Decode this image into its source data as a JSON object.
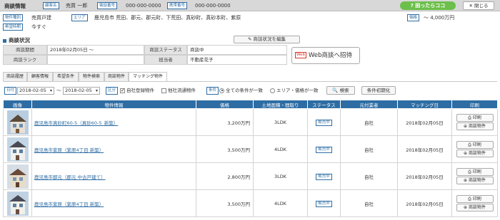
{
  "header": {
    "title": "商談情報",
    "status_tag": "顧客名",
    "status_value": "売買 一郎",
    "phone_tag": "電話番号",
    "phone_value": "000-000-0000",
    "mobile_tag": "携帯番号",
    "mobile_value": "000-000-0000",
    "help_label": "困ったらココ",
    "close_label": "閉じる"
  },
  "conditions": {
    "type_tag": "物件種別",
    "type_value": "売買戸建",
    "area_tag": "エリア",
    "area_value": "鹿児島市 荒田、郡元、郡元町、下荒田、真砂町、真砂本町、紫原",
    "price_tag": "価格",
    "price_value": "～ 4,000万円",
    "timing_tag": "希望時期",
    "timing_value": "今すぐ"
  },
  "negotiation": {
    "section_title": "商談状況",
    "edit_label": "商談状況を編集",
    "period_label": "商談期間",
    "period_value": "2018年02月05日 ～",
    "status_label": "商談ステータス",
    "status_value": "商談中",
    "rank_label": "商談ランク",
    "rank_value": "",
    "staff_label": "担当者",
    "staff_value": "不動産花子",
    "web_tag": "Web",
    "web_label": "Web商談へ招待"
  },
  "tabs": [
    "商談履歴",
    "顧客情報",
    "希望条件",
    "物件検索",
    "商談物件",
    "マッチング物件"
  ],
  "active_tab": "マッチング物件",
  "filters": {
    "date_tag": "日付",
    "date_from": "2018-02-05",
    "date_sep": "～",
    "date_to": "2018-02-05",
    "category_tag": "区分",
    "own_label": "自社登録物件",
    "other_label": "他社流通物件",
    "cond_tag": "条件",
    "all_label": "全ての条件が一致",
    "area_price_label": "エリア・価格が一致",
    "search_label": "検索",
    "reset_label": "条件初期化"
  },
  "table": {
    "headers": [
      "画像",
      "物件情報",
      "価格",
      "土地面積・間取り",
      "ステータス",
      "元付業者",
      "マッチング日",
      "印刷"
    ],
    "rows": [
      {
        "name": "鹿児島市真砂町60-5（真砂60-5_新築）",
        "price": "3,200万円",
        "layout": "3LDK",
        "status": "販売中",
        "agent": "自社",
        "date": "2018年02月05日"
      },
      {
        "name": "鹿児島市紫原（紫原4丁目 新築）",
        "price": "3,500万円",
        "layout": "4LDK",
        "status": "販売中",
        "agent": "自社",
        "date": "2018年02月05日"
      },
      {
        "name": "鹿児島市郡元（郡元 中古戸建て）",
        "price": "2,800万円",
        "layout": "3LDK",
        "status": "販売中",
        "agent": "自社",
        "date": "2018年02月05日"
      },
      {
        "name": "鹿児島市紫原（紫原4丁目 新築）",
        "price": "3,500万円",
        "layout": "4LDK",
        "status": "販売中",
        "agent": "自社",
        "date": "2018年02月05日"
      }
    ],
    "print_label": "印刷",
    "deal_label": "商談物件"
  },
  "colors": {
    "accent": "#2e6da4",
    "help": "#6cbf4a",
    "web_red": "#d9342b"
  }
}
